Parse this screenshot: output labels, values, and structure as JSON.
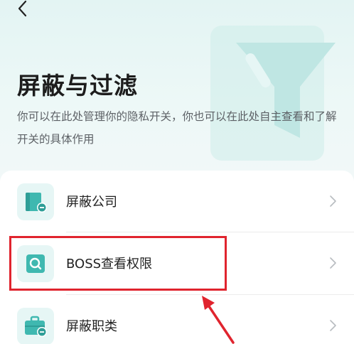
{
  "header": {
    "title": "屏蔽与过滤",
    "description": "你可以在此处管理你的隐私开关，你也可以在此处自主查看和了解开关的具体作用"
  },
  "menu": {
    "items": [
      {
        "label": "屏蔽公司",
        "icon": "block-company-icon"
      },
      {
        "label": "BOSS查看权限",
        "icon": "boss-view-permission-icon"
      },
      {
        "label": "屏蔽职类",
        "icon": "block-job-category-icon"
      }
    ]
  },
  "annotation": {
    "highlight_color": "#e0242e",
    "highlighted_item": "BOSS查看权限"
  },
  "colors": {
    "accent": "#3fb8b0",
    "icon_bg": "#e6f6f5",
    "text_primary": "#1d1d1d",
    "text_secondary": "#5d6166"
  }
}
